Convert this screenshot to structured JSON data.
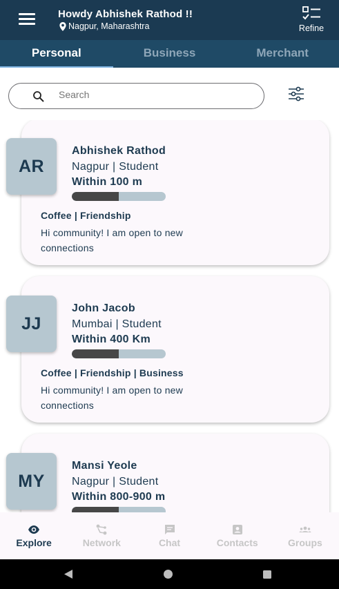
{
  "header": {
    "greeting": "Howdy Abhishek Rathod !!",
    "location": "Nagpur, Maharashtra",
    "refine_label": "Refine",
    "background": "#1b3a52"
  },
  "tabs": [
    {
      "label": "Personal",
      "active": true
    },
    {
      "label": "Business",
      "active": false
    },
    {
      "label": "Merchant",
      "active": false
    }
  ],
  "search": {
    "placeholder": "Search",
    "value": ""
  },
  "cards": [
    {
      "initials": "AR",
      "name": "Abhishek Rathod",
      "subtitle": "Nagpur | Student",
      "distance": "Within 100 m",
      "progress": 0.5,
      "tags": "Coffee | Friendship",
      "bio": "Hi community! I am open to new connections"
    },
    {
      "initials": "JJ",
      "name": "John Jacob",
      "subtitle": "Mumbai | Student",
      "distance": "Within 400 Km",
      "progress": 0.5,
      "tags": "Coffee | Friendship | Business",
      "bio": "Hi community! I am open to new connections"
    },
    {
      "initials": "MY",
      "name": "Mansi Yeole",
      "subtitle": "Nagpur | Student",
      "distance": "Within 800-900 m",
      "progress": 0.5,
      "tags": "",
      "bio": ""
    }
  ],
  "bottom_nav": [
    {
      "label": "Explore",
      "icon": "eye-icon",
      "active": true
    },
    {
      "label": "Network",
      "icon": "network-icon",
      "active": false
    },
    {
      "label": "Chat",
      "icon": "chat-icon",
      "active": false
    },
    {
      "label": "Contacts",
      "icon": "contacts-icon",
      "active": false
    },
    {
      "label": "Groups",
      "icon": "groups-icon",
      "active": false
    }
  ],
  "colors": {
    "primary": "#1d3a50",
    "tab_bar": "#1f4a66",
    "avatar_bg": "#b6c7d0",
    "card_bg": "#fcf8fc",
    "progress_fill": "#474747"
  }
}
